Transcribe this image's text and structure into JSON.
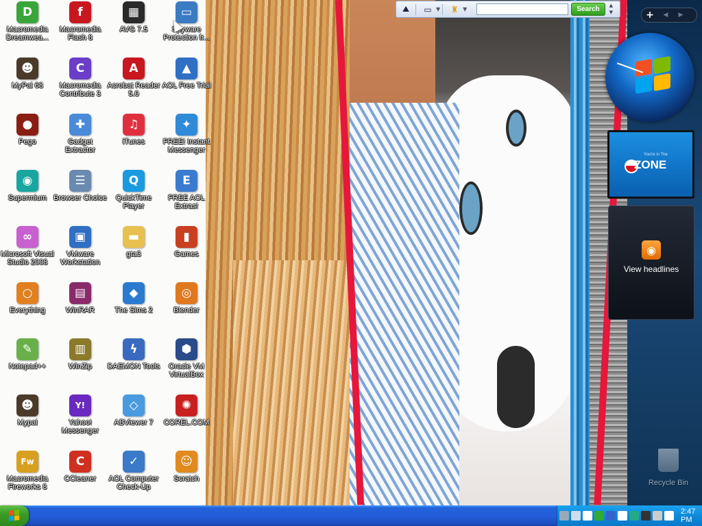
{
  "desktop": {
    "icons": [
      {
        "label": "Macromedia Dreamwea...",
        "icon": "dreamweaver-icon",
        "color": "#3aa53a",
        "glyph": "D"
      },
      {
        "label": "Macromedia Flash 8",
        "icon": "flash-icon",
        "color": "#c8171e",
        "glyph": "f"
      },
      {
        "label": "AVG 7.5",
        "icon": "avg-icon",
        "color": "#2a2a2a",
        "glyph": "▦"
      },
      {
        "label": "Spyware Protection fr...",
        "icon": "spyware-protection-icon",
        "color": "#3a7bc4",
        "glyph": "▭"
      },
      {
        "label": "MyPal 68",
        "icon": "raccoon-icon",
        "color": "#4a3a2a",
        "glyph": "☻"
      },
      {
        "label": "Macromedia Contribute 3",
        "icon": "contribute-icon",
        "color": "#6a3ec8",
        "glyph": "C"
      },
      {
        "label": "Acrobat Reader 5.0",
        "icon": "acrobat-icon",
        "color": "#c8171e",
        "glyph": "A"
      },
      {
        "label": "AOL Free Trial",
        "icon": "aol-icon",
        "color": "#2f6fc4",
        "glyph": "▲"
      },
      {
        "label": "Pego",
        "icon": "pego-icon",
        "color": "#8a1e12",
        "glyph": "●"
      },
      {
        "label": "Gadget Extractor",
        "icon": "gadget-icon",
        "color": "#4a8ad8",
        "glyph": "✚"
      },
      {
        "label": "iTunes",
        "icon": "itunes-icon",
        "color": "#e03040",
        "glyph": "♫"
      },
      {
        "label": "FREE! Instant Messenger",
        "icon": "aim-icon",
        "color": "#2f8ad8",
        "glyph": "✦"
      },
      {
        "label": "Supermium",
        "icon": "supermium-icon",
        "color": "#1aa6a0",
        "glyph": "◉"
      },
      {
        "label": "Browser Choice",
        "icon": "browser-choice-icon",
        "color": "#6a8ab0",
        "glyph": "☰"
      },
      {
        "label": "QuickTime Player",
        "icon": "quicktime-icon",
        "color": "#1a9ae0",
        "glyph": "Q"
      },
      {
        "label": "FREE AOL Extras!",
        "icon": "aol-extras-icon",
        "color": "#3a7bd0",
        "glyph": "E"
      },
      {
        "label": "Microsoft Visual Studio 2008",
        "icon": "visual-studio-icon",
        "color": "#c860d0",
        "glyph": "∞"
      },
      {
        "label": "VMware Workstation",
        "icon": "vmware-icon",
        "color": "#2f6fc4",
        "glyph": "▣"
      },
      {
        "label": "gta3",
        "icon": "folder-icon",
        "color": "#e8c050",
        "glyph": "▬"
      },
      {
        "label": "Games",
        "icon": "games-icon",
        "color": "#c84020",
        "glyph": "▮"
      },
      {
        "label": "Everything",
        "icon": "everything-icon",
        "color": "#e08020",
        "glyph": "○"
      },
      {
        "label": "WinRAR",
        "icon": "winrar-icon",
        "color": "#8a2a6a",
        "glyph": "▤"
      },
      {
        "label": "The Sims 2",
        "icon": "sims-icon",
        "color": "#2a7ad0",
        "glyph": "◆"
      },
      {
        "label": "Blender",
        "icon": "blender-icon",
        "color": "#e07820",
        "glyph": "◎"
      },
      {
        "label": "Notepad++",
        "icon": "notepadpp-icon",
        "color": "#6ab04a",
        "glyph": "✎"
      },
      {
        "label": "WinZip",
        "icon": "winzip-icon",
        "color": "#8a7a2a",
        "glyph": "▥"
      },
      {
        "label": "DAEMON Tools",
        "icon": "daemon-tools-icon",
        "color": "#3a6ac0",
        "glyph": "ϟ"
      },
      {
        "label": "Oracle VM VirtualBox",
        "icon": "virtualbox-icon",
        "color": "#2a4a8a",
        "glyph": "⬢"
      },
      {
        "label": "Mypal",
        "icon": "raccoon-icon",
        "color": "#4a3a2a",
        "glyph": "☻"
      },
      {
        "label": "Yahoo! Messenger",
        "icon": "yahoo-messenger-icon",
        "color": "#6a2ac0",
        "glyph": "Y!"
      },
      {
        "label": "ABViewer 7",
        "icon": "abviewer-icon",
        "color": "#4a9ae0",
        "glyph": "◇"
      },
      {
        "label": "COREL.COM",
        "icon": "corel-icon",
        "color": "#c82020",
        "glyph": "✺"
      },
      {
        "label": "Macromedia Fireworks 8",
        "icon": "fireworks-icon",
        "color": "#d8a020",
        "glyph": "Fw"
      },
      {
        "label": "CCleaner",
        "icon": "ccleaner-icon",
        "color": "#d03020",
        "glyph": "C"
      },
      {
        "label": "AOL Computer Check-Up",
        "icon": "aol-checkup-icon",
        "color": "#3a7ac8",
        "glyph": "✓"
      },
      {
        "label": "Scratch",
        "icon": "scratch-icon",
        "color": "#e08a20",
        "glyph": "☺"
      }
    ],
    "recycle_bin": {
      "label": "Recycle Bin",
      "icon": "recycle-bin-icon"
    }
  },
  "search_toolbar": {
    "search_placeholder": "",
    "search_button": "Search",
    "buttons": [
      "toolbar-logo-icon",
      "messenger-icon",
      "aim-running-man-icon"
    ]
  },
  "sidebar": {
    "add_button": "+",
    "zone_gadget": {
      "small_text": "You're in The",
      "title": "ZONE"
    },
    "headlines_gadget": {
      "label": "View headlines"
    }
  },
  "taskbar": {
    "start_icon": "windows-logo-icon",
    "tray_icons": [
      "network-icon",
      "volume-icon",
      "security-icon",
      "green-shield-icon",
      "blue-shield-icon",
      "dashboard-icon",
      "chat-icon",
      "display-icon",
      "messenger-tray-icon",
      "clock-tray-icon"
    ],
    "clock": "2:47 PM"
  },
  "colors": {
    "taskbar_blue": "#245edb",
    "start_green": "#3a9d25",
    "tray_blue": "#0f8ad9",
    "search_green": "#2f9b1d"
  }
}
